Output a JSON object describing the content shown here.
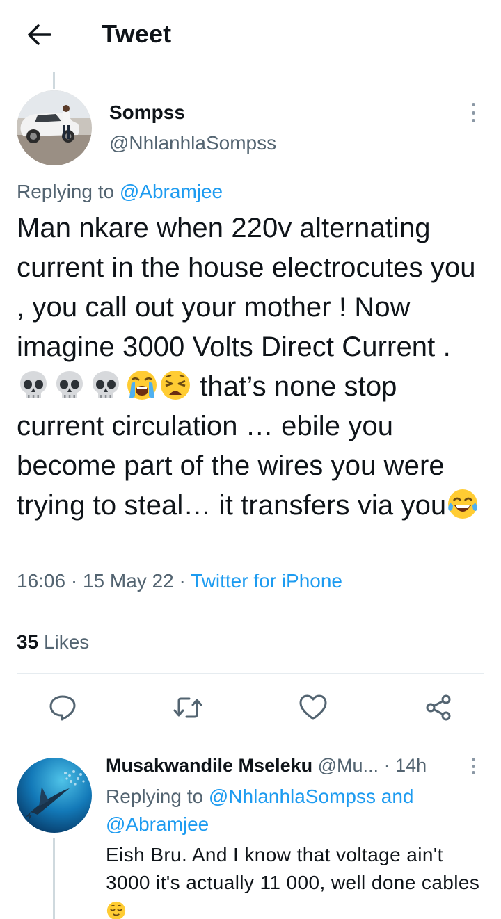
{
  "header": {
    "title": "Tweet",
    "back_icon": "arrow-left-icon"
  },
  "tweet": {
    "author_name": "Sompss",
    "author_handle": "@NhlanhlaSompss",
    "replying_prefix": "Replying to",
    "replying_to": "@Abramjee",
    "text_part1": "Man nkare when 220v alternating current in the house electrocutes you , you call out your mother ! Now imagine 3000 Volts Direct Current . ",
    "text_part2": " that’s none stop current circulation … ebile you become part of the wires you were trying to steal… it transfers via you",
    "emojis": [
      "skull",
      "skull",
      "skull",
      "loudly-crying-face",
      "weary-face"
    ],
    "trailing_emoji": "face-with-tears-of-joy",
    "time": "16:06",
    "date": "15 May 22",
    "source": "Twitter for iPhone",
    "likes_count": "35",
    "likes_label": "Likes"
  },
  "actions": [
    {
      "name": "reply",
      "icon": "reply-icon"
    },
    {
      "name": "retweet",
      "icon": "retweet-icon"
    },
    {
      "name": "like",
      "icon": "heart-icon"
    },
    {
      "name": "share",
      "icon": "share-icon"
    }
  ],
  "reply": {
    "author_name": "Musakwandile Mseleku",
    "author_handle": "@Mu...",
    "separator": "·",
    "time": "14h",
    "replying_prefix": "Replying to",
    "replying_to_1": "@NhlanhlaSompss",
    "replying_and": "and",
    "replying_to_2": "@Abramjee",
    "text": "Eish Bru. And I know that voltage ain't 3000 it's actually 11 000, well done cables ",
    "trailing_emoji": "relieved-face"
  },
  "colors": {
    "accent": "#1d9bf0",
    "text_primary": "#0f1419",
    "text_secondary": "#536471",
    "divider": "#e6ecf0"
  }
}
